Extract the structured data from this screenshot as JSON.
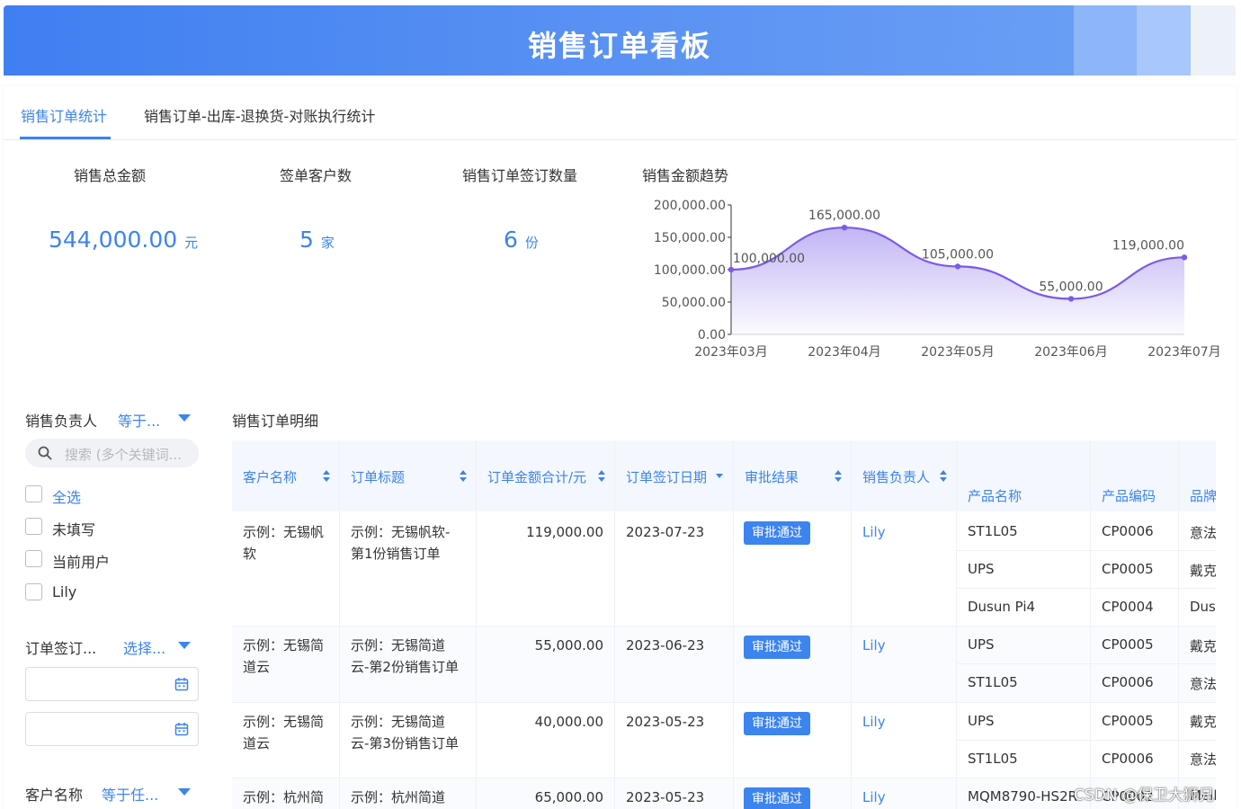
{
  "header": {
    "title": "销售订单看板"
  },
  "tabs": [
    {
      "label": "销售订单统计",
      "active": true
    },
    {
      "label": "销售订单-出库-退换货-对账执行统计",
      "active": false
    }
  ],
  "kpis": {
    "total_amount": {
      "label": "销售总金额",
      "value": "544,000.00",
      "unit": "元"
    },
    "customers": {
      "label": "签单客户数",
      "value": "5",
      "unit": "家"
    },
    "orders": {
      "label": "销售订单签订数量",
      "value": "6",
      "unit": "份"
    }
  },
  "trend": {
    "title": "销售金额趋势"
  },
  "chart_data": {
    "type": "area",
    "title": "销售金额趋势",
    "categories": [
      "2023年03月",
      "2023年04月",
      "2023年05月",
      "2023年06月",
      "2023年07月"
    ],
    "values": [
      100000,
      165000,
      105000,
      55000,
      119000
    ],
    "data_labels": [
      "100,000.00",
      "165,000.00",
      "105,000.00",
      "55,000.00",
      "119,000.00"
    ],
    "y_ticks": [
      "0.00",
      "50,000.00",
      "100,000.00",
      "150,000.00",
      "200,000.00"
    ],
    "ylim": [
      0,
      200000
    ],
    "grid": false,
    "color": "#7b5be8"
  },
  "filters": {
    "owner": {
      "label": "销售负责人",
      "selector": "等于..."
    },
    "search": {
      "placeholder": "搜索 (多个关键词..."
    },
    "options": [
      "全选",
      "未填写",
      "当前用户",
      "Lily"
    ],
    "date": {
      "label": "订单签订...",
      "selector": "选择..."
    },
    "customer": {
      "label": "客户名称",
      "selector": "等于任..."
    }
  },
  "table": {
    "title": "销售订单明细",
    "columns": [
      "客户名称",
      "订单标题",
      "订单金额合计/元",
      "订单签订日期",
      "审批结果",
      "销售负责人"
    ],
    "sub_columns": [
      "产品名称",
      "产品编码",
      "品牌"
    ],
    "rows": [
      {
        "customer": [
          "示例：无锡帆",
          "软"
        ],
        "title": [
          "示例：无锡帆软-",
          "第1份销售订单"
        ],
        "amount": "119,000.00",
        "date": "2023-07-23",
        "approval": "审批通过",
        "owner": "Lily",
        "products": [
          {
            "name": "ST1L05",
            "code": "CP0006",
            "brand": "意法"
          },
          {
            "name": "UPS",
            "code": "CP0005",
            "brand": "戴克"
          },
          {
            "name": "Dusun Pi4",
            "code": "CP0004",
            "brand": "Dusun"
          }
        ]
      },
      {
        "customer": [
          "示例：无锡简",
          "道云"
        ],
        "title": [
          "示例：无锡简道",
          "云-第2份销售订单"
        ],
        "amount": "55,000.00",
        "date": "2023-06-23",
        "approval": "审批通过",
        "owner": "Lily",
        "products": [
          {
            "name": "UPS",
            "code": "CP0005",
            "brand": "戴克"
          },
          {
            "name": "ST1L05",
            "code": "CP0006",
            "brand": "意法"
          }
        ]
      },
      {
        "customer": [
          "示例：无锡简",
          "道云"
        ],
        "title": [
          "示例：无锡简道",
          "云-第3份销售订单"
        ],
        "amount": "40,000.00",
        "date": "2023-05-23",
        "approval": "审批通过",
        "owner": "Lily",
        "products": [
          {
            "name": "UPS",
            "code": "CP0005",
            "brand": "戴克"
          },
          {
            "name": "ST1L05",
            "code": "CP0006",
            "brand": "意法"
          }
        ]
      },
      {
        "customer": [
          "示例：杭州简",
          ""
        ],
        "title": [
          "示例：杭州简道",
          ""
        ],
        "amount": "65,000.00",
        "date": "2023-05-23",
        "approval": "审批通过",
        "owner": "Lily",
        "products": [
          {
            "name": "MQM8790-HS2R",
            "code": "CP0002",
            "brand": "Mell"
          }
        ]
      }
    ]
  },
  "watermark": "CSDN @保卫大狮兄",
  "colors": {
    "accent": "#3c84ee",
    "chart_line": "#7b5be8",
    "header": "#4a88f2"
  }
}
